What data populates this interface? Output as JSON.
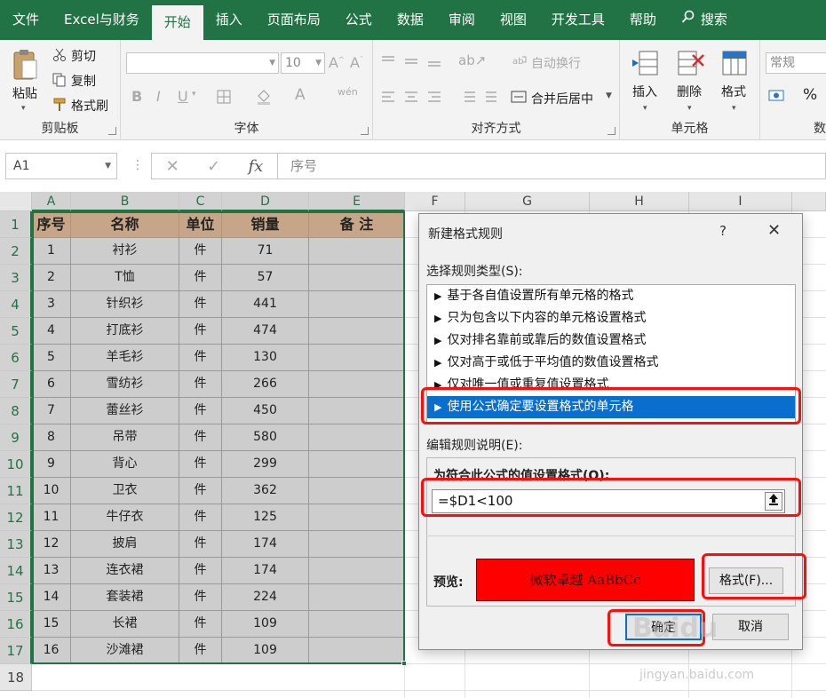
{
  "ribbon_tabs": [
    "文件",
    "Excel与财务",
    "开始",
    "插入",
    "页面布局",
    "公式",
    "数据",
    "审阅",
    "视图",
    "开发工具",
    "帮助",
    "搜索"
  ],
  "active_tab": "开始",
  "clipboard": {
    "paste": "粘贴",
    "cut": "剪切",
    "copy": "复制",
    "format_painter": "格式刷",
    "label": "剪贴板"
  },
  "font": {
    "size": "10",
    "label": "字体",
    "bold": "B",
    "italic": "I",
    "underline": "U"
  },
  "alignment": {
    "wrap": "自动换行",
    "merge": "合并后居中",
    "label": "对齐方式"
  },
  "cells": {
    "insert": "插入",
    "delete": "删除",
    "format": "格式",
    "label": "单元格"
  },
  "number": {
    "format": "常规",
    "label": "数",
    "percent": "%"
  },
  "formula_bar": {
    "name_box": "A1",
    "content": "序号",
    "cancel": "✕",
    "enter": "✓",
    "fx": "fx"
  },
  "columns": [
    "A",
    "B",
    "C",
    "D",
    "E",
    "F",
    "G",
    "H",
    "I"
  ],
  "rows": [
    "1",
    "2",
    "3",
    "4",
    "5",
    "6",
    "7",
    "8",
    "9",
    "10",
    "11",
    "12",
    "13",
    "14",
    "15",
    "16",
    "17",
    "18"
  ],
  "table": {
    "headers": [
      "序号",
      "名称",
      "单位",
      "销量",
      "备 注"
    ],
    "rows": [
      [
        "1",
        "衬衫",
        "件",
        "71",
        ""
      ],
      [
        "2",
        "T恤",
        "件",
        "57",
        ""
      ],
      [
        "3",
        "针织衫",
        "件",
        "441",
        ""
      ],
      [
        "4",
        "打底衫",
        "件",
        "474",
        ""
      ],
      [
        "5",
        "羊毛衫",
        "件",
        "130",
        ""
      ],
      [
        "6",
        "雪纺衫",
        "件",
        "266",
        ""
      ],
      [
        "7",
        "蕾丝衫",
        "件",
        "450",
        ""
      ],
      [
        "8",
        "吊带",
        "件",
        "580",
        ""
      ],
      [
        "9",
        "背心",
        "件",
        "299",
        ""
      ],
      [
        "10",
        "卫衣",
        "件",
        "362",
        ""
      ],
      [
        "11",
        "牛仔衣",
        "件",
        "125",
        ""
      ],
      [
        "12",
        "披肩",
        "件",
        "174",
        ""
      ],
      [
        "13",
        "连衣裙",
        "件",
        "174",
        ""
      ],
      [
        "14",
        "套装裙",
        "件",
        "224",
        ""
      ],
      [
        "15",
        "长裙",
        "件",
        "109",
        ""
      ],
      [
        "16",
        "沙滩裙",
        "件",
        "109",
        ""
      ]
    ]
  },
  "dialog": {
    "title": "新建格式规则",
    "help": "?",
    "close": "✕",
    "select_rule_label": "选择规则类型(S):",
    "rule_types": [
      "基于各自值设置所有单元格的格式",
      "只为包含以下内容的单元格设置格式",
      "仅对排名靠前或靠后的数值设置格式",
      "仅对高于或低于平均值的数值设置格式",
      "仅对唯一值或重复值设置格式",
      "使用公式确定要设置格式的单元格"
    ],
    "selected_rule_index": 5,
    "edit_rule_label": "编辑规则说明(E):",
    "formula_label": "为符合此公式的值设置格式(O):",
    "formula_value": "=$D1<100",
    "preview_label": "预览:",
    "preview_text": "微软卓越  AaBbCc",
    "format_button": "格式(F)...",
    "ok_button": "确定",
    "cancel_button": "取消"
  },
  "colors": {
    "ribbon_green": "#217346",
    "header_fill": "#c7a589",
    "cell_fill": "#cdcdcd",
    "selection_blue": "#0a6ece",
    "preview_red": "#ff0000",
    "highlight_red": "#ff0d0d"
  },
  "watermark": {
    "brand": "Baidu",
    "site": "jingyan.baidu.com"
  }
}
